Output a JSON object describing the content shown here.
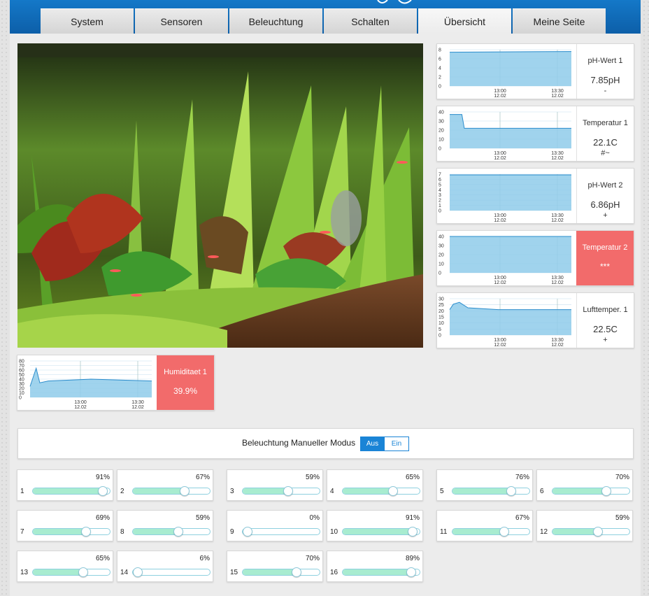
{
  "tabs": [
    {
      "label": "System"
    },
    {
      "label": "Sensoren"
    },
    {
      "label": "Beleuchtung"
    },
    {
      "label": "Schalten"
    },
    {
      "label": "Übersicht"
    },
    {
      "label": "Meine Seite"
    }
  ],
  "active_tab": "Übersicht",
  "sensors": [
    {
      "name": "pH-Wert 1",
      "value": "7.85pH",
      "trend": "-",
      "alarm": false,
      "y_ticks": [
        "8",
        "6",
        "4",
        "2",
        "0"
      ],
      "x_ticks": [
        [
          "13:00",
          "12.02"
        ],
        [
          "13:30",
          "12.02"
        ]
      ]
    },
    {
      "name": "Temperatur 1",
      "value": "22.1C",
      "trend": "#~",
      "alarm": false,
      "y_ticks": [
        "40",
        "30",
        "20",
        "10",
        "0"
      ],
      "x_ticks": [
        [
          "13:00",
          "12.02"
        ],
        [
          "13:30",
          "12.02"
        ]
      ]
    },
    {
      "name": "pH-Wert 2",
      "value": "6.86pH",
      "trend": "+",
      "alarm": false,
      "y_ticks": [
        "7",
        "6",
        "5",
        "4",
        "3",
        "2",
        "1",
        "0"
      ],
      "x_ticks": [
        [
          "13:00",
          "12.02"
        ],
        [
          "13:30",
          "12.02"
        ]
      ]
    },
    {
      "name": "Temperatur 2",
      "value": "***",
      "trend": "",
      "alarm": true,
      "y_ticks": [
        "40",
        "30",
        "20",
        "10",
        "0"
      ],
      "x_ticks": [
        [
          "13:00",
          "12.02"
        ],
        [
          "13:30",
          "12.02"
        ]
      ]
    },
    {
      "name": "Lufttemper. 1",
      "value": "22.5C",
      "trend": "+",
      "alarm": false,
      "y_ticks": [
        "30",
        "25",
        "20",
        "15",
        "10",
        "5",
        "0"
      ],
      "x_ticks": [
        [
          "13:00",
          "12.02"
        ],
        [
          "13:30",
          "12.02"
        ]
      ]
    },
    {
      "name": "Humiditaet 1",
      "value": "39.9%",
      "trend": "",
      "alarm": true,
      "y_ticks": [
        "80",
        "70",
        "60",
        "50",
        "40",
        "30",
        "20",
        "10",
        "0"
      ],
      "x_ticks": [
        [
          "13:00",
          "12.02"
        ],
        [
          "13:30",
          "12.02"
        ]
      ]
    }
  ],
  "lighting": {
    "label": "Beleuchtung Manueller Modus",
    "off_label": "Aus",
    "on_label": "Ein",
    "selected": "Aus"
  },
  "channels": [
    {
      "number": "1",
      "percent": "91%",
      "level": 91
    },
    {
      "number": "2",
      "percent": "67%",
      "level": 67
    },
    {
      "number": "3",
      "percent": "59%",
      "level": 59
    },
    {
      "number": "4",
      "percent": "65%",
      "level": 65
    },
    {
      "number": "5",
      "percent": "76%",
      "level": 76
    },
    {
      "number": "6",
      "percent": "70%",
      "level": 70
    },
    {
      "number": "7",
      "percent": "69%",
      "level": 69
    },
    {
      "number": "8",
      "percent": "59%",
      "level": 59
    },
    {
      "number": "9",
      "percent": "0%",
      "level": 0
    },
    {
      "number": "10",
      "percent": "91%",
      "level": 91
    },
    {
      "number": "11",
      "percent": "67%",
      "level": 67
    },
    {
      "number": "12",
      "percent": "59%",
      "level": 59
    },
    {
      "number": "13",
      "percent": "65%",
      "level": 65
    },
    {
      "number": "14",
      "percent": "6%",
      "level": 6
    },
    {
      "number": "15",
      "percent": "70%",
      "level": 70
    },
    {
      "number": "16",
      "percent": "89%",
      "level": 89
    }
  ],
  "colors": {
    "header": "#1274c4",
    "alarm": "#f26b6b",
    "chart_fill": "#8fcbea",
    "chart_line": "#2a8ccc",
    "slider_fill": "#a8ecd0",
    "toggle_active": "#1a84d6"
  }
}
